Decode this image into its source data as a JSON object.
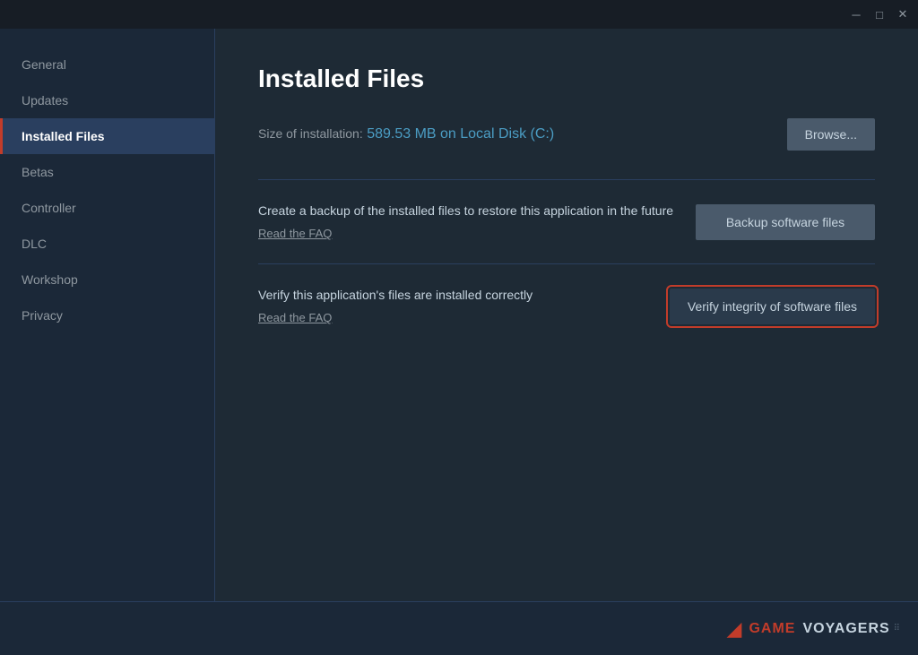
{
  "titlebar": {
    "minimize_label": "─",
    "maximize_label": "□",
    "close_label": "✕"
  },
  "sidebar": {
    "items": [
      {
        "id": "general",
        "label": "General",
        "active": false
      },
      {
        "id": "updates",
        "label": "Updates",
        "active": false
      },
      {
        "id": "installed-files",
        "label": "Installed Files",
        "active": true
      },
      {
        "id": "betas",
        "label": "Betas",
        "active": false
      },
      {
        "id": "controller",
        "label": "Controller",
        "active": false
      },
      {
        "id": "dlc",
        "label": "DLC",
        "active": false
      },
      {
        "id": "workshop",
        "label": "Workshop",
        "active": false
      },
      {
        "id": "privacy",
        "label": "Privacy",
        "active": false
      }
    ]
  },
  "main": {
    "page_title": "Installed Files",
    "install_size_label": "Size of installation:",
    "install_size_value": "589.53 MB on Local Disk (C:)",
    "browse_button": "Browse...",
    "sections": [
      {
        "id": "backup",
        "description": "Create a backup of the installed files to restore this application in the future",
        "link_text": "Read the FAQ",
        "button_label": "Backup software files",
        "highlighted": false
      },
      {
        "id": "verify",
        "description": "Verify this application's files are installed correctly",
        "link_text": "Read the FAQ",
        "button_label": "Verify integrity of software files",
        "highlighted": true
      }
    ]
  },
  "logo": {
    "game_text": "GAME",
    "voyagers_text": "VOYAGERS"
  }
}
